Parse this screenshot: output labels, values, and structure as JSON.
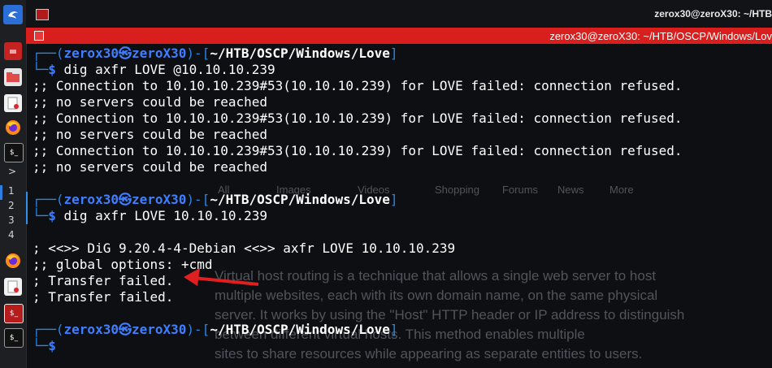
{
  "window": {
    "top_title": "zerox30@zeroX30: ~/HTB",
    "tab_title": "zerox30@zeroX30: ~/HTB/OSCP/Windows/Lov"
  },
  "taskbar": {
    "workspaces": [
      "1",
      "2",
      "3",
      "4"
    ],
    "chevron": ">",
    "icons": [
      "kali-dragon-icon",
      "red-app-icon",
      "folder-icon",
      "text-editor-icon",
      "firefox-icon",
      "terminal-icon",
      "firefox-icon",
      "text-editor-icon",
      "terminal-red-icon",
      "terminal-icon"
    ]
  },
  "prompt": {
    "corner_top": "┌──(",
    "user": "zerox30㉿zeroX30",
    "mid": ")-[",
    "path": "~/HTB/OSCP/Windows/Love",
    "end": "]",
    "corner_bottom": "└─",
    "dollar": "$"
  },
  "commands": [
    "dig axfr LOVE @10.10.10.239",
    "dig axfr LOVE 10.10.10.239"
  ],
  "output1": [
    ";; Connection to 10.10.10.239#53(10.10.10.239) for LOVE failed: connection refused.",
    ";; no servers could be reached",
    ";; Connection to 10.10.10.239#53(10.10.10.239) for LOVE failed: connection refused.",
    ";; no servers could be reached",
    ";; Connection to 10.10.10.239#53(10.10.10.239) for LOVE failed: connection refused.",
    ";; no servers could be reached"
  ],
  "output2": [
    "; <<>> DiG 9.20.4-4-Debian <<>> axfr LOVE 10.10.10.239",
    ";; global options: +cmd",
    "; Transfer failed.",
    "; Transfer failed."
  ],
  "background_text": {
    "nav": [
      "All",
      "Images",
      "Videos",
      "Shopping",
      "Forums",
      "News",
      "More"
    ],
    "paragraph": [
      "Virtual host routing is a technique that allows a single web server to host",
      "multiple websites, each with its own domain name, on the same physical",
      "server. It works by using the \"Host\" HTTP header or IP address to distinguish",
      "between different virtual hosts. This method enables multiple",
      "sites to share resources while appearing as separate entities to users."
    ]
  },
  "colors": {
    "prompt_blue": "#3f7fff",
    "bracket_blue": "#2a86e8",
    "arrow_red": "#e02020",
    "tab_red": "#d91e1e"
  }
}
